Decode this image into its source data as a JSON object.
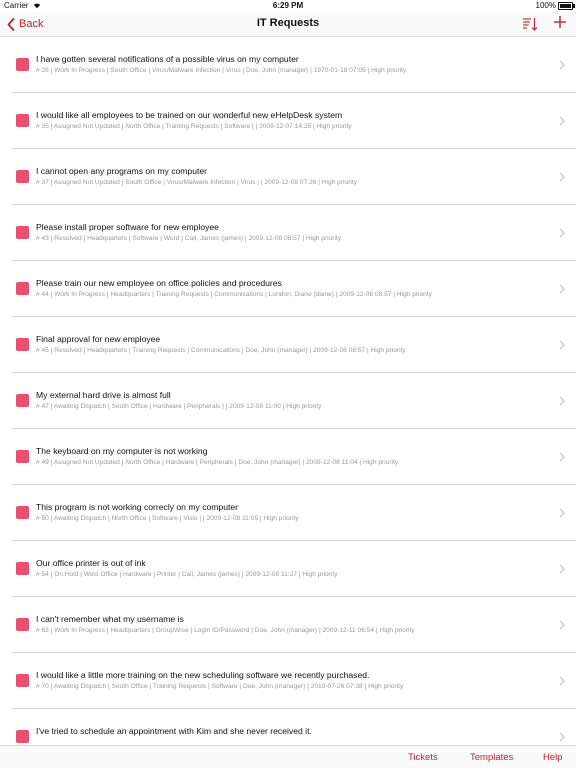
{
  "status_bar": {
    "carrier": "Carrier",
    "time": "6:29 PM",
    "battery": "100%"
  },
  "nav": {
    "back_label": "Back",
    "title": "IT Requests"
  },
  "colors": {
    "accent": "#c0212c",
    "priority_high": "#e8506d"
  },
  "tickets": [
    {
      "title": "I have gotten several notifications of a possible virus on my computer",
      "subtitle": "# 28 | Work In Progress | South Office | Virus/Malware Infection | Virus | Doe, John (manager) | 1970-01-18 07:05 | High priority"
    },
    {
      "title": "I would like all employees to be trained on our wonderful new eHelpDesk system",
      "subtitle": "# 35 | Assigned Not Updated | North Office | Training Requests | Software |  | 2009-12-07 14:25 | High priority"
    },
    {
      "title": "I cannot open any programs on my computer",
      "subtitle": "# 37 | Assigned Not Updated | South Office | Virus/Malware Infection | Virus |  | 2009-12-08 07:26 | High priority"
    },
    {
      "title": "Please install proper software for new employee",
      "subtitle": "# 43 | Resolved | Headquarters | Software | Word | Call, James (james) | 2009-12-08 08:57 | High priority"
    },
    {
      "title": "Please train our new employee on office policies and procedures",
      "subtitle": "# 44 | Work In Progress | Headquarters | Training Requests | Communications | London, Diane (diane) | 2009-12-08 08:57 | High priority"
    },
    {
      "title": "Final approval for new employee",
      "subtitle": "# 45 | Resolved | Headquarters | Training Requests | Communications | Doe, John (manager) | 2009-12-08 08:57 | High priority"
    },
    {
      "title": "My external hard drive is almost full",
      "subtitle": "# 47 | Awaiting Dispatch | South Office | Hardware | Peripherals |  | 2009-12-08 11:00 | High priority"
    },
    {
      "title": "The keyboard on my computer is not working",
      "subtitle": "# 49 | Assigned Not Updated | North Office | Hardware | Peripherals | Doe, John (manager) | 2009-12-08 11:04 | High priority"
    },
    {
      "title": "This program is not working correcly on my computer",
      "subtitle": "# 50 | Awaiting Dispatch | North Office | Software | Visio |  | 2009-12-08 11:05 | High priority"
    },
    {
      "title": "Our office printer is out of ink",
      "subtitle": "# 54 | On Hold | West Office | Hardware | Printer | Call, James (james) | 2009-12-08 11:27 | High priority"
    },
    {
      "title": "I can't remember what my username is",
      "subtitle": "# 63 | Work In Progress | Headquarters | GroupWise | Login ID/Password | Doe, John (manager) | 2009-12-11 06:54 | High priority"
    },
    {
      "title": "I would like a little more training on the new scheduling software we recently purchased.",
      "subtitle": "# 70 | Awaiting Dispatch | South Office | Training Requests | Software | Doe, John (manager) | 2010-07-26 07:38 | High priority"
    },
    {
      "title": "I've tried to schedule an appointment with Kim and she never received it.",
      "subtitle": ""
    }
  ],
  "tabs": {
    "tickets": "Tickets",
    "templates": "Templates",
    "help": "Help"
  }
}
